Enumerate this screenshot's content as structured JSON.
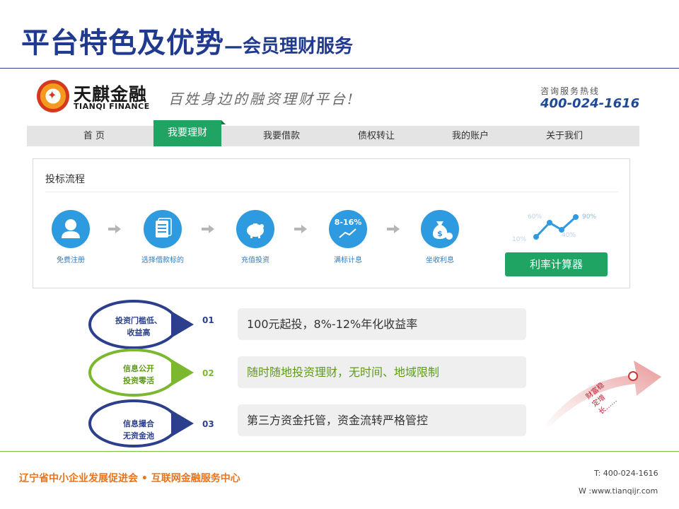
{
  "title": {
    "main": "平台特色及优势",
    "dash": "—",
    "sub": "会员理财服务"
  },
  "brand": {
    "name_cn": "天麒金融",
    "name_en": "TIANQI FINANCE",
    "slogan": "百姓身边的融资理财平台!",
    "hotline_label": "咨询服务热线",
    "hotline_number": "400-024-1616"
  },
  "nav": {
    "items": [
      "首 页",
      "我要理财",
      "我要借款",
      "债权转让",
      "我的账户",
      "关于我们"
    ],
    "active": "我要理财"
  },
  "process": {
    "title": "投标流程",
    "steps": [
      {
        "label": "免费注册",
        "icon": "user-icon"
      },
      {
        "label": "选择借款标的",
        "icon": "document-list-icon"
      },
      {
        "label": "充值投资",
        "icon": "piggy-bank-icon"
      },
      {
        "label": "满标计息",
        "icon": "rate-growth-icon",
        "text": "8-16%"
      },
      {
        "label": "坐收利息",
        "icon": "money-bag-icon"
      }
    ],
    "mini_chart": {
      "points": [
        "10%",
        "60%",
        "40%",
        "90%"
      ]
    },
    "calc_button": "利率计算器"
  },
  "features": [
    {
      "bubble_line1": "投资门槛低、",
      "bubble_line2": "收益高",
      "num": "01",
      "text": "100元起投，8%-12%年化收益率",
      "color": "#2b3f8c"
    },
    {
      "bubble_line1": "信息公开",
      "bubble_line2": "投资零活",
      "num": "02",
      "text": "随时随地投资理财，无时间、地域限制",
      "color": "#7cb82f"
    },
    {
      "bubble_line1": "信息撮合",
      "bubble_line2": "无资金池",
      "num": "03",
      "text": "第三方资金托管，资金流转严格管控",
      "color": "#2b3f8c"
    }
  ],
  "deco_text": [
    "财富稳",
    "定增",
    "长……"
  ],
  "footer": {
    "org": "辽宁省中小企业发展促进会 • 互联网金融服务中心",
    "tel": "T: 400-024-1616",
    "web": "W :www.tianqijr.com"
  }
}
